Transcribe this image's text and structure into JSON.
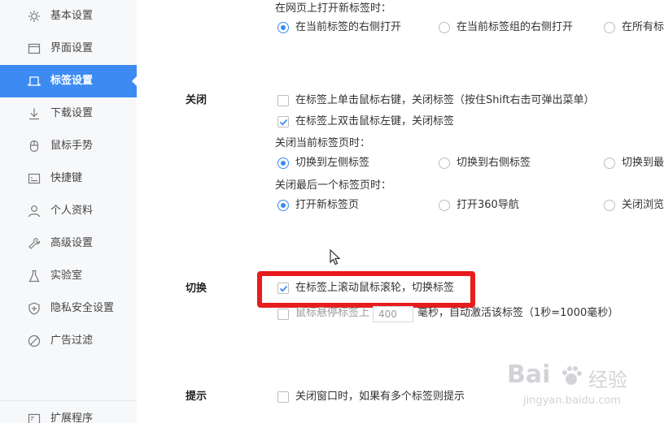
{
  "sidebar": {
    "items": [
      {
        "label": "基本设置",
        "icon": "gear-icon"
      },
      {
        "label": "界面设置",
        "icon": "window-icon"
      },
      {
        "label": "标签设置",
        "icon": "tab-icon"
      },
      {
        "label": "下载设置",
        "icon": "download-icon"
      },
      {
        "label": "鼠标手势",
        "icon": "mouse-icon"
      },
      {
        "label": "快捷键",
        "icon": "keyboard-icon"
      },
      {
        "label": "个人资料",
        "icon": "user-icon"
      },
      {
        "label": "高级设置",
        "icon": "wrench-icon"
      },
      {
        "label": "实验室",
        "icon": "flask-icon"
      },
      {
        "label": "隐私安全设置",
        "icon": "shield-icon"
      },
      {
        "label": "广告过滤",
        "icon": "block-icon"
      },
      {
        "label": "扩展程序",
        "icon": "extension-icon"
      }
    ],
    "active_index": 2,
    "accent_color": "#3d8bf2"
  },
  "open_section": {
    "prompt": "在网页上打开新标签时：",
    "options": [
      "在当前标签的右侧打开",
      "在当前标签组的右侧打开",
      "在所有标"
    ],
    "selected": 0
  },
  "close_section": {
    "title": "关闭",
    "check_right_click": "在标签上单击鼠标右键，关闭标签（按住Shift右击可弹出菜单）",
    "check_right_click_checked": false,
    "check_double_click": "在标签上双击鼠标左键，关闭标签",
    "check_double_click_checked": true,
    "close_current_prompt": "关闭当前标签页时：",
    "close_current_options": [
      "切换到左侧标签",
      "切换到右侧标签",
      "切换到最"
    ],
    "close_current_selected": 0,
    "close_last_prompt": "关闭最后一个标签页时：",
    "close_last_options": [
      "打开新标签页",
      "打开360导航",
      "关闭浏览"
    ],
    "close_last_selected": 0
  },
  "switch_section": {
    "title": "切换",
    "check_wheel": "在标签上滚动鼠标滚轮，切换标签",
    "check_wheel_checked": true,
    "hover_prefix": "鼠标悬停标签上",
    "hover_value": "400",
    "hover_suffix": "毫秒，自动激活该标签（1秒=1000毫秒）",
    "hover_checked": false,
    "highlight_color": "#e81c1c"
  },
  "hint_section": {
    "title": "提示",
    "check_warn_close": "关闭窗口时，如果有多个标签则提示",
    "check_warn_close_checked": false
  },
  "watermark": {
    "brand": "Bai",
    "brand2": "经验",
    "url": "jingyan.baidu.com"
  }
}
